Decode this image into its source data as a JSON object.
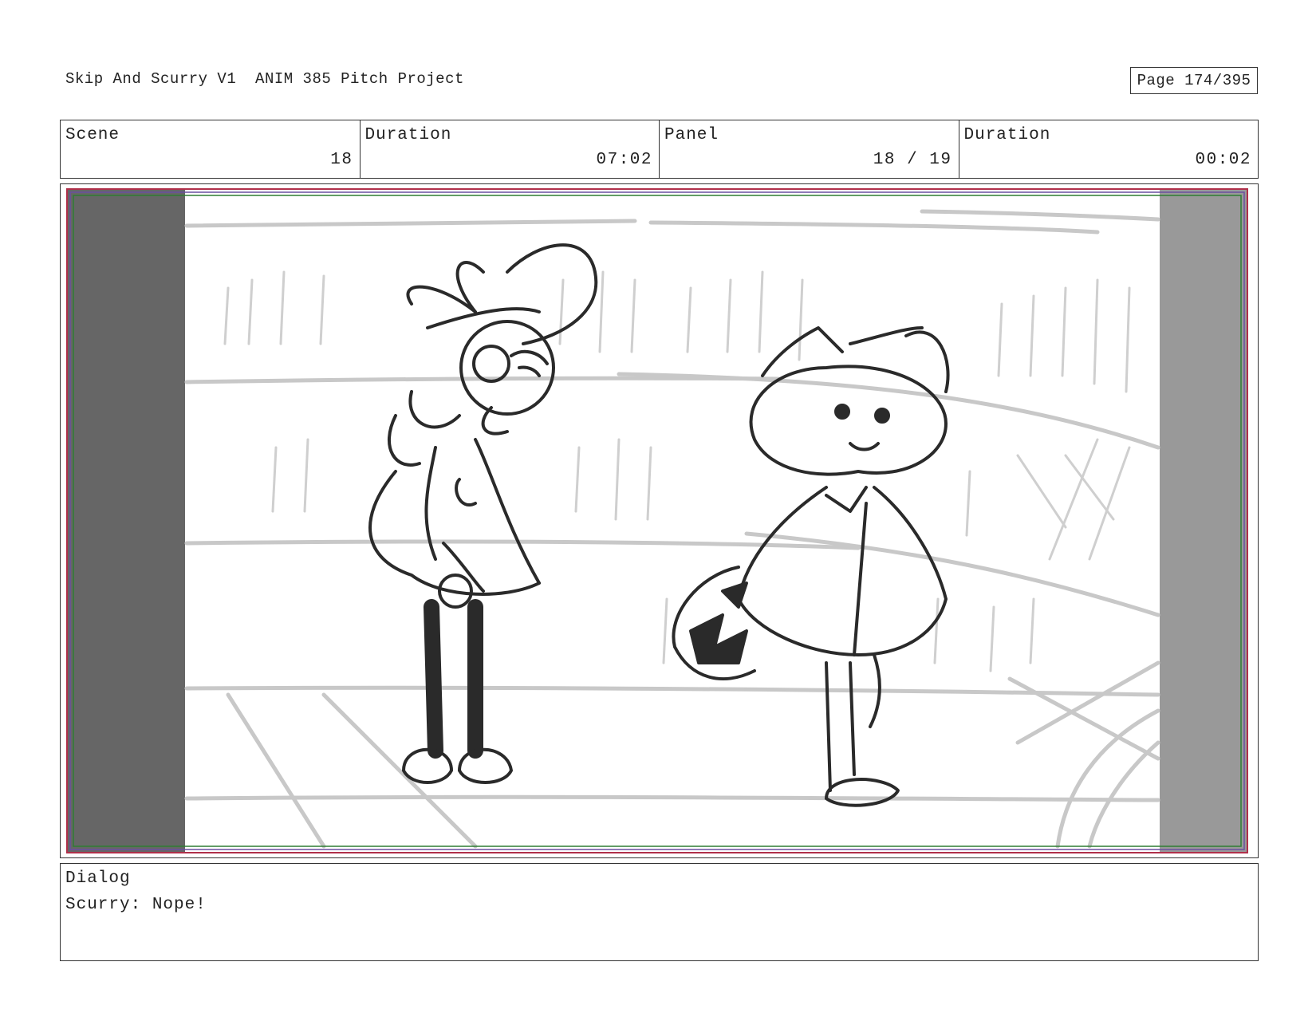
{
  "header": {
    "title": "Skip And Scurry V1  ANIM 385 Pitch Project",
    "page": "Page 174/395"
  },
  "info": {
    "scene_label": "Scene",
    "scene_value": "18",
    "scene_duration_label": "Duration",
    "scene_duration_value": "07:02",
    "panel_label": "Panel",
    "panel_value": "18 / 19",
    "panel_duration_label": "Duration",
    "panel_duration_value": "00:02"
  },
  "dialog": {
    "label": "Dialog",
    "text": "Scurry: Nope!"
  },
  "colors": {
    "safe_frame_red": "#b0304a",
    "safe_frame_green": "#2e7d32",
    "safe_frame_purple": "#6a4fa0",
    "letterbox_left": "#666666",
    "letterbox_right": "#999999"
  }
}
